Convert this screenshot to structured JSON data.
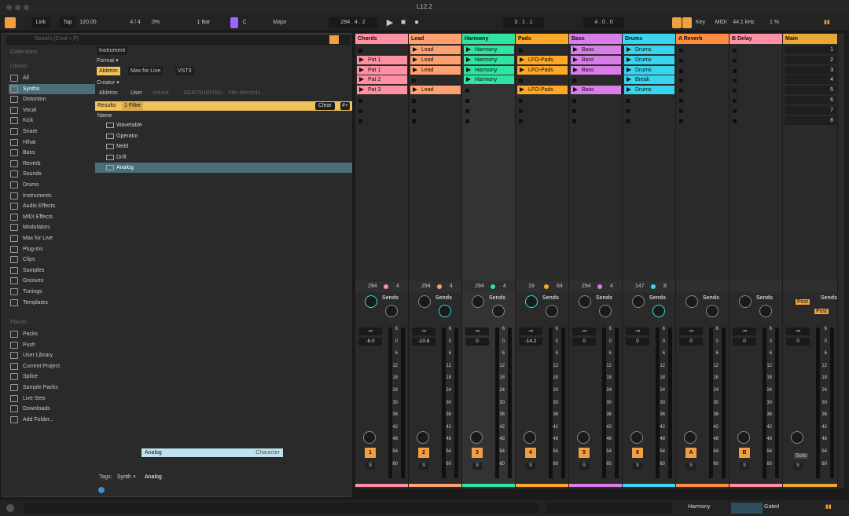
{
  "title": "L12.2",
  "toolbar": {
    "link": "Link",
    "tap": "Tap",
    "tempo": "120.00",
    "sig": "4 / 4",
    "swing": "0%",
    "quant": "1 Bar",
    "key": "C",
    "scale": "Major",
    "pos": "294 .  4 .  2",
    "loop_start": "3 .  1 .  1",
    "loop_len": "4 .  0 .  0",
    "key_btn": "Key",
    "midi": "MIDI",
    "rate": "44.1 kHz",
    "cpu": "1 %"
  },
  "browser": {
    "search_placeholder": "Search (Cmd + F)",
    "collections_label": "Collections",
    "library_label": "Library",
    "places_label": "Places",
    "library": [
      "All",
      "Synths",
      "Distortion",
      "Vocal",
      "Kick",
      "Snare",
      "Hihat",
      "Bass",
      "Reverb",
      "Sounds",
      "Drums",
      "Instruments",
      "Audio Effects",
      "MIDI Effects",
      "Modulators",
      "Max for Live",
      "Plug-Ins",
      "Clips",
      "Samples",
      "Grooves",
      "Tunings",
      "Templates"
    ],
    "places": [
      "Packs",
      "Push",
      "User Library",
      "Current Project",
      "Splice",
      "Sample Packs",
      "Live Sets",
      "Downloads",
      "Add Folder..."
    ],
    "filter_instrument": "Instrument",
    "format_label": "Format ▾",
    "formats": [
      "Ableton",
      "Max for Live",
      "VST3"
    ],
    "creator_label": "Creator ▾",
    "creators": [
      "Ableton",
      "User",
      "Arturia",
      "BEATSURFING",
      "Xfer Records"
    ],
    "results": "Results",
    "filter_count": "1 Filter",
    "clear": "Clear",
    "name_header": "Name",
    "files": [
      "Wavetable",
      "Operator",
      "Meld",
      "Drift",
      "Analog"
    ],
    "tags_label": "Tags:",
    "tag": "Synth ×",
    "tag_input": "Analog",
    "ac_item": "Analog",
    "ac_type": "Character"
  },
  "tracks": [
    {
      "name": "Chords",
      "color": "#ff8fa3",
      "num": "1",
      "vol": "-6.0",
      "tempo": "294",
      "t2": "4",
      "clips": [
        "",
        "Pat 1",
        "Pat 1",
        "Pat 2",
        "Pat 3"
      ]
    },
    {
      "name": "Lead",
      "color": "#ffa070",
      "num": "2",
      "vol": "-10.6",
      "tempo": "294",
      "t2": "4",
      "clips": [
        "Lead",
        "Lead",
        "Lead",
        "",
        "Lead"
      ]
    },
    {
      "name": "Harmony",
      "color": "#2fe3a0",
      "num": "3",
      "vol": "0",
      "tempo": "294",
      "t2": "4",
      "clips": [
        "Harmony",
        "Harmony",
        "Harmony",
        "Harmony",
        ""
      ]
    },
    {
      "name": "Pads",
      "color": "#ffa726",
      "num": "4",
      "vol": "-14.2",
      "tempo": "19",
      "t2": "64",
      "clips": [
        "",
        "LFO-Pads",
        "LFO-Pads",
        "",
        "LFO-Pads"
      ]
    },
    {
      "name": "Bass",
      "color": "#d97ee8",
      "num": "5",
      "vol": "0",
      "tempo": "294",
      "t2": "4",
      "clips": [
        "Bass",
        "Bass",
        "Bass",
        "",
        "Bass"
      ]
    },
    {
      "name": "Drums",
      "color": "#39d4ee",
      "num": "6",
      "vol": "0",
      "tempo": "147",
      "t2": "8",
      "clips": [
        "Drums",
        "Drums",
        "Drums",
        "Break",
        "Drums"
      ]
    },
    {
      "name": "A Reverb",
      "color": "#ff8c40",
      "num": "A",
      "vol": "0",
      "tempo": "",
      "t2": "",
      "clips": []
    },
    {
      "name": "B Delay",
      "color": "#ff8fa3",
      "num": "B",
      "vol": "0",
      "tempo": "",
      "t2": "",
      "clips": []
    },
    {
      "name": "Main",
      "color": "#e8a838",
      "num": "",
      "vol": "0",
      "tempo": "",
      "t2": "",
      "clips": []
    }
  ],
  "scenes": [
    "1",
    "2",
    "3",
    "4",
    "5",
    "6",
    "7",
    "8"
  ],
  "sends": "Sends",
  "post": "Post",
  "solo": "Solo",
  "inf": "-∞",
  "scale": [
    "6",
    "0",
    "6",
    "12",
    "18",
    "24",
    "30",
    "36",
    "42",
    "48",
    "54",
    "60"
  ],
  "status": {
    "track": "Harmony",
    "device": "Gated"
  }
}
